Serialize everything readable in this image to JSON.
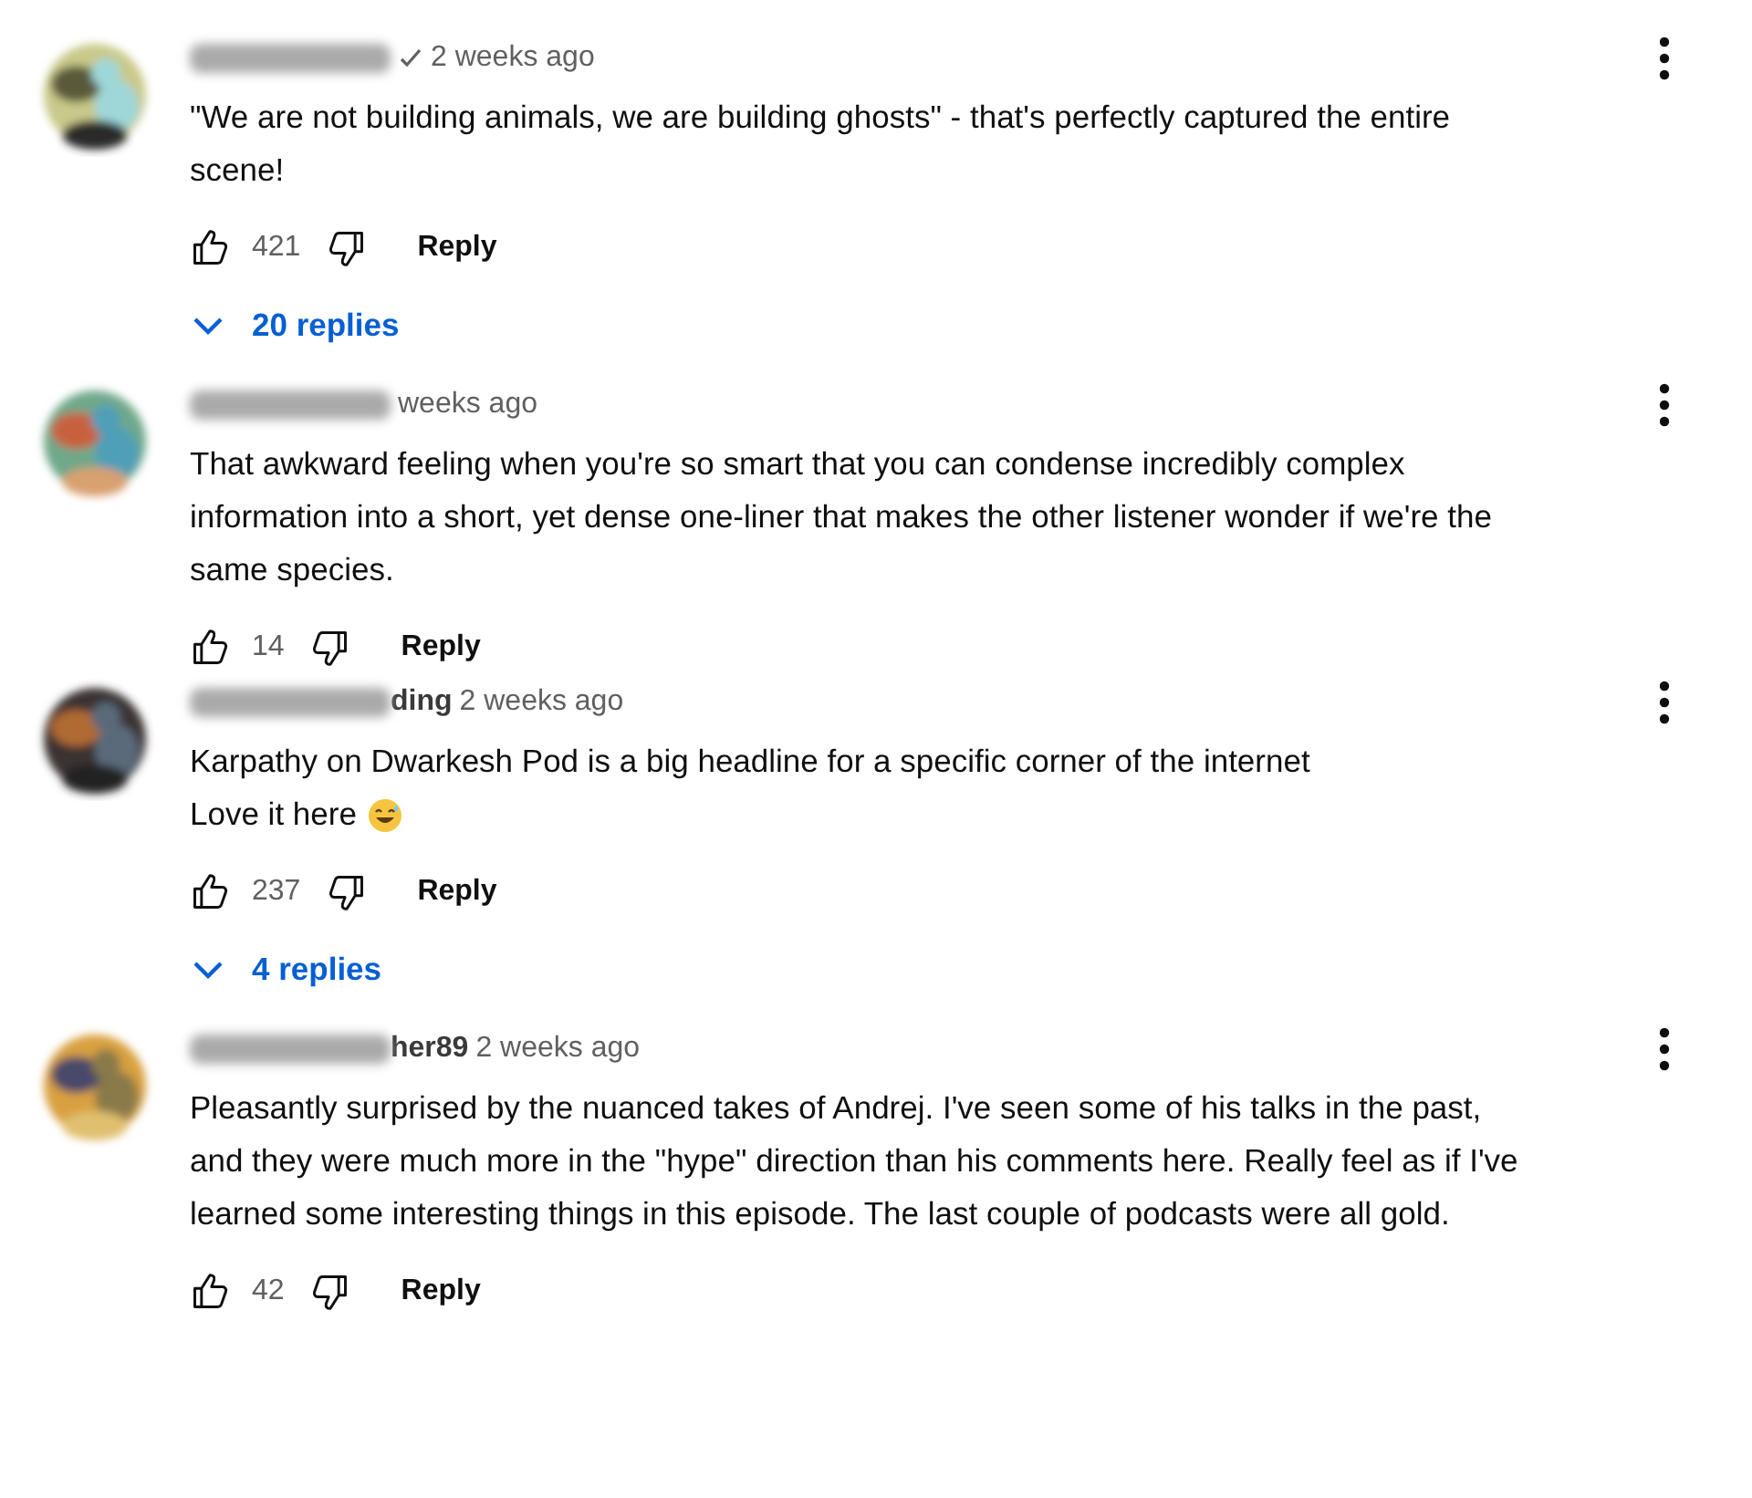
{
  "comments": [
    {
      "verified": true,
      "time": "2 weeks ago",
      "lines": [
        "\"We are not building animals, we are building ghosts\" - that's perfectly captured the entire",
        "scene!"
      ],
      "trailing_emoji": false,
      "likes": "421",
      "reply": "Reply",
      "replies": "20 replies"
    },
    {
      "verified": false,
      "time": "weeks ago",
      "lines": [
        "That awkward feeling when you're so smart that you can condense incredibly complex",
        "information into a short, yet dense one-liner that makes the other listener wonder if we're the",
        "same species."
      ],
      "trailing_emoji": false,
      "likes": "14",
      "reply": "Reply"
    },
    {
      "name_fragment": "ding",
      "verified": false,
      "time": "2 weeks ago",
      "lines": [
        "Karpathy on Dwarkesh Pod is a big headline for a specific corner of the internet",
        "Love it here"
      ],
      "trailing_emoji": true,
      "likes": "237",
      "reply": "Reply",
      "replies": "4 replies"
    },
    {
      "name_fragment": "her89",
      "verified": false,
      "time": "2 weeks ago",
      "lines": [
        "Pleasantly surprised by the nuanced takes of Andrej. I've seen some of his talks in the past,",
        "and they were much more in the \"hype\" direction than his comments here. Really feel as if I've",
        "learned some interesting things in this episode. The last couple of podcasts were all gold."
      ],
      "trailing_emoji": false,
      "likes": "42",
      "reply": "Reply"
    }
  ]
}
